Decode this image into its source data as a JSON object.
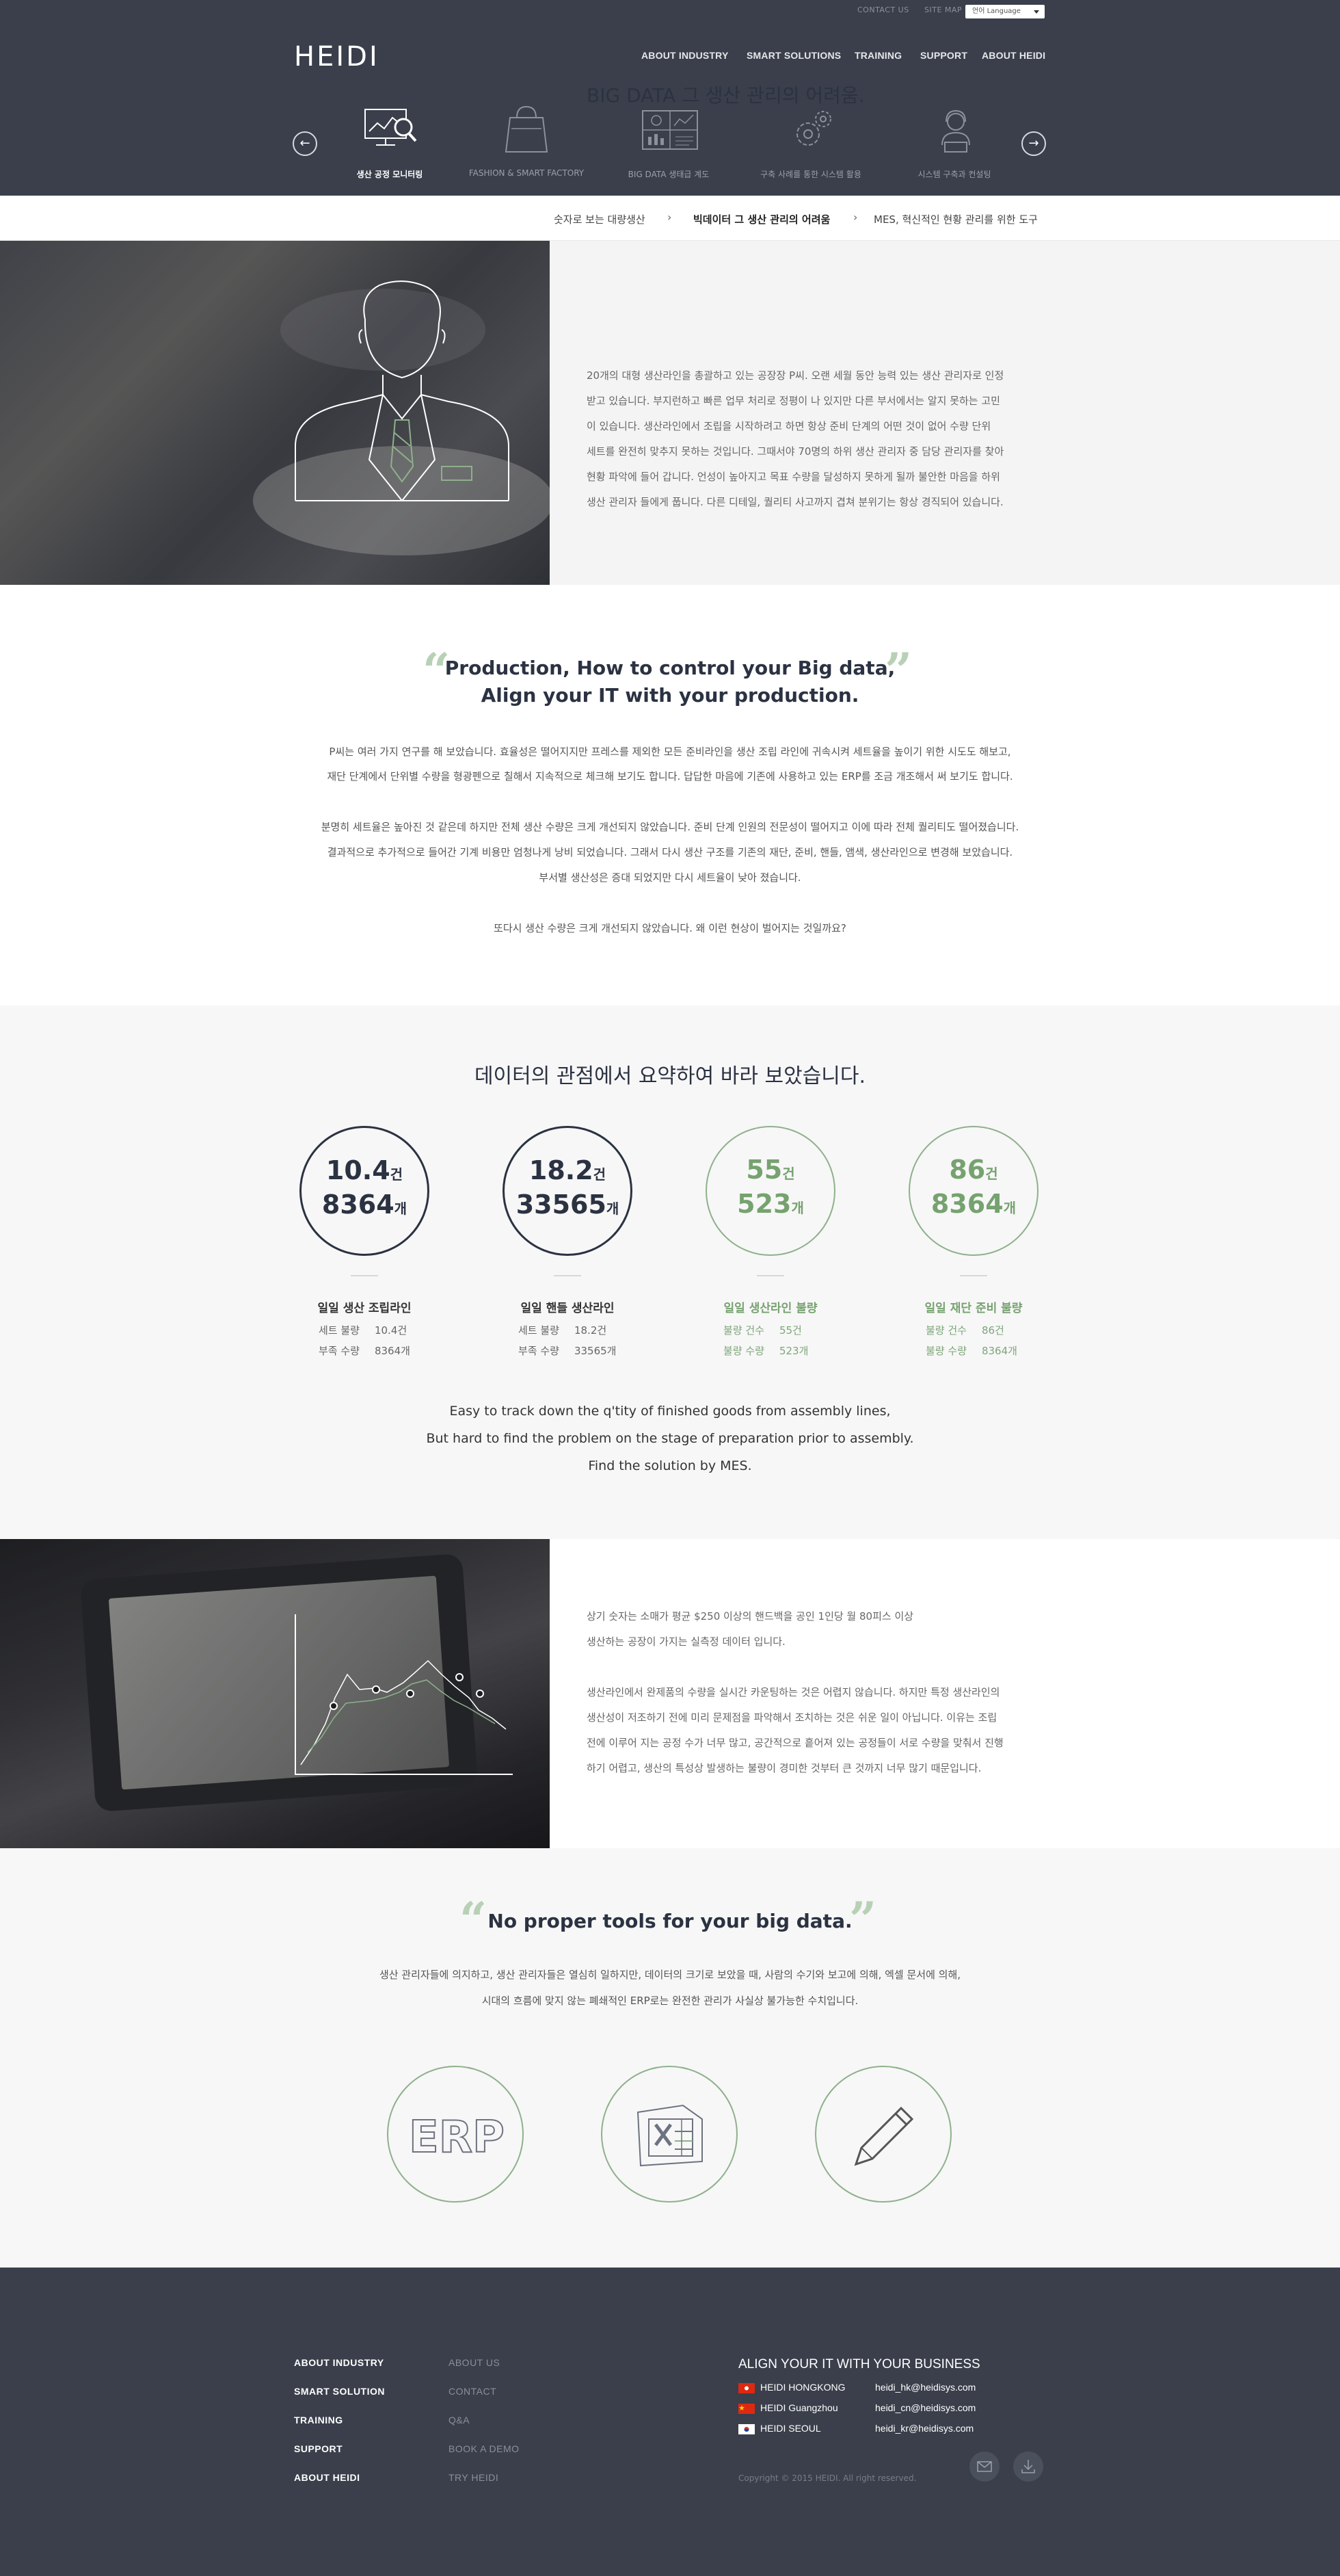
{
  "util": {
    "contact": "CONTACT US",
    "sitemap": "SITE MAP",
    "language": "언어 Language"
  },
  "brand": "HEIDI",
  "gnav": [
    "ABOUT INDUSTRY",
    "SMART SOLUTIONS",
    "TRAINING",
    "SUPPORT",
    "ABOUT HEIDI"
  ],
  "categories": [
    {
      "label": "생산 공정 모니터링",
      "icon": "monitor-search-icon",
      "active": true
    },
    {
      "label": "FASHION & SMART FACTORY",
      "icon": "shopping-bag-icon"
    },
    {
      "label": "BIG DATA 생태급 계도",
      "icon": "dashboard-icon"
    },
    {
      "label": "구축 사례를 통한 시스템 활용",
      "icon": "gears-icon"
    },
    {
      "label": "시스템 구축과 컨설팅",
      "icon": "consultant-headset-icon"
    }
  ],
  "breadcrumb": [
    "숫자로 보는 대량생산",
    "빅데이터 그 생산 관리의 어려움",
    "MES, 혁신적인 현황 관리를 위한 도구"
  ],
  "sec1": {
    "title": "BIG DATA 그 생산 관리의 어려움.",
    "lines": [
      "20개의 대형 생산라인을 총괄하고 있는 공장장 P씨. 오랜 세월 동안 능력 있는 생산 관리자로 인정",
      "받고 있습니다. 부지런하고 빠른 업무 처리로 정평이 나 있지만 다른 부서에서는 알지 못하는 고민",
      "이 있습니다. 생산라인에서 조립을 시작하려고 하면 항상 준비 단계의 어떤 것이 없어 수량 단위",
      "세트를 완전히 맞추지 못하는 것입니다. 그때서야 70명의 하위 생산 관리자 중 담당 관리자를 찾아",
      "현황 파악에 들어 갑니다. 언성이 높아지고 목표 수량을 달성하지 못하게 될까 불안한 마음을 하위",
      "생산 관리자 들에게 풉니다.  다른 디테일, 퀄리티 사고까지 겹쳐 분위기는 항상 경직되어 있습니다."
    ]
  },
  "sec2": {
    "headline1": "Production, How to control your Big data,",
    "headline2": "Align your IT with your production.",
    "para1": [
      "P씨는 여러 가지 연구를 해 보았습니다. 효율성은 떨어지지만 프레스를 제외한 모든 준비라인을 생산 조립 라인에  귀속시켜 세트율을 높이기 위한 시도도 해보고,",
      "재단 단계에서 단위별 수량을 형광펜으로 칠해서 지속적으로 체크해 보기도 합니다. 답답한 마음에 기존에 사용하고 있는 ERP를 조금 개조해서 써 보기도 합니다."
    ],
    "para2": [
      "분명히 세트율은 높아진 것 같은데 하지만 전체 생산 수량은 크게 개선되지 않았습니다. 준비 단계 인원의 전문성이 떨어지고 이에 따라 전체 퀄리티도 떨어졌습니다.",
      "결과적으로 추가적으로 들어간 기계 비용만 엄청나게 낭비 되었습니다. 그래서 다시 생산 구조를 기존의 재단, 준비, 핸들, 앰색, 생산라인으로 변경해 보았습니다.",
      "부서별 생산성은 증대 되었지만 다시 세트율이 낮아 졌습니다."
    ],
    "para3": "또다시 생산 수량은 크게 개선되지 않았습니다.  왜 이런 현상이 벌어지는 것일까요?"
  },
  "sec3": {
    "title": "데이터의 관점에서 요약하여 바라 보았습니다.",
    "stats": [
      {
        "num1": "10.4",
        "unit1": "건",
        "num2": "8364",
        "unit2": "개",
        "title": "일일 생산 조립라인",
        "rows": [
          [
            "세트 불량",
            "10.4건"
          ],
          [
            "부족 수량",
            "8364개"
          ]
        ],
        "accent": "dark"
      },
      {
        "num1": "18.2",
        "unit1": "건",
        "num2": "33565",
        "unit2": "개",
        "title": "일일 핸들 생산라인",
        "rows": [
          [
            "세트 불량",
            "18.2건"
          ],
          [
            "부족 수량",
            "33565개"
          ]
        ],
        "accent": "dark"
      },
      {
        "num1": "55",
        "unit1": "건",
        "num2": "523",
        "unit2": "개",
        "title": "일일 생산라인 불량",
        "rows": [
          [
            "불량 건수",
            "55건"
          ],
          [
            "불량 수량",
            "523개"
          ]
        ],
        "accent": "green"
      },
      {
        "num1": "86",
        "unit1": "건",
        "num2": "8364",
        "unit2": "개",
        "title": "일일 재단 준비 불량",
        "rows": [
          [
            "불량 건수",
            "86건"
          ],
          [
            "불량 수량",
            "8364개"
          ]
        ],
        "accent": "green"
      }
    ],
    "eng": [
      "Easy to track down the q'tity of finished goods from assembly lines,",
      "But hard to find the problem on the stage of preparation prior to assembly.",
      "Find the solution by MES."
    ]
  },
  "sec4": {
    "para1": [
      "상기 숫자는 소매가 평균 $250 이상의 핸드백을 공인 1인당 월 80피스 이상",
      "생산하는 공장이 가지는 실측정 데이터 입니다."
    ],
    "para2": [
      "생산라인에서 완제품의 수량을 실시간 카운팅하는 것은 어렵지 않습니다.  하지만 특정 생산라인의",
      "생산성이 저조하기 전에 미리 문제점을 파악해서 조치하는 것은 쉬운 일이 아닙니다.  이유는 조립",
      "전에 이루어 지는 공정 수가 너무 많고, 공간적으로 흩어져 있는 공정들이 서로 수량을 맞춰서 진행",
      "하기 어렵고, 생산의 특성상 발생하는 불량이 경미한 것부터 큰 것까지 너무 많기 때문입니다."
    ]
  },
  "sec5": {
    "headline": "No proper tools for your big data.",
    "lines": [
      "생산 관리자들에 의지하고, 생산 관리자들은 열심히 일하지만, 데이터의 크기로 보았을 때, 사람의 수기와 보고에 의해, 엑셀 문서에 의해,",
      "시대의 흐름에 맞지 않는 폐쇄적인 ERP로는 완전한 관리가 사실상 불가능한 수치입니다."
    ],
    "erp": "ERP",
    "tools": [
      "erp-icon",
      "excel-icon",
      "pencil-icon"
    ]
  },
  "footer": {
    "menu": [
      "ABOUT INDUSTRY",
      "SMART SOLUTION",
      "TRAINING",
      "SUPPORT",
      "ABOUT HEIDI"
    ],
    "sub": [
      "ABOUT US",
      "CONTACT",
      "Q&A",
      "BOOK A DEMO",
      "TRY HEIDI"
    ],
    "tagline": "ALIGN YOUR IT WITH YOUR BUSINESS",
    "offices": [
      {
        "name": "HEIDI  HONGKONG",
        "email": "heidi_hk@heidisys.com",
        "flag": "hongkong-flag-icon"
      },
      {
        "name": "HEIDI  Guangzhou",
        "email": "heidi_cn@heidisys.com",
        "flag": "china-flag-icon"
      },
      {
        "name": "HEIDI  SEOUL",
        "email": "heidi_kr@heidisys.com",
        "flag": "korea-flag-icon"
      }
    ],
    "copyright": "Copyright © 2015 HEIDI. All right reserved.",
    "icons": [
      "mail-icon",
      "download-icon"
    ]
  },
  "colors": {
    "navy": "#3a3f4b",
    "title": "#2b3242",
    "green": "#8fb08c",
    "quote": "#b8d1b6"
  }
}
